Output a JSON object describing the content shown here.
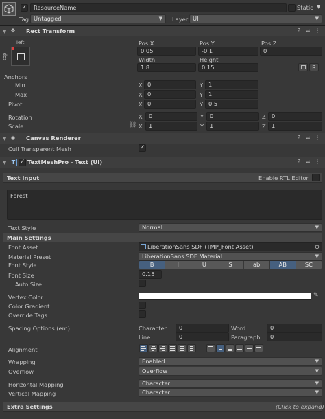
{
  "header": {
    "object_name": "ResourceName",
    "static_label": "Static",
    "tag_label": "Tag",
    "tag_value": "Untagged",
    "layer_label": "Layer",
    "layer_value": "UI"
  },
  "rect_transform": {
    "title": "Rect Transform",
    "anchor_preset_top": "left",
    "anchor_preset_side": "top",
    "pos_x_label": "Pos X",
    "pos_x": "0.05",
    "pos_y_label": "Pos Y",
    "pos_y": "-0.1",
    "pos_z_label": "Pos Z",
    "pos_z": "0",
    "width_label": "Width",
    "width": "1.8",
    "height_label": "Height",
    "height": "0.15",
    "r_button": "R",
    "anchors_label": "Anchors",
    "min_label": "Min",
    "min_x": "0",
    "min_y": "1",
    "max_label": "Max",
    "max_x": "0",
    "max_y": "1",
    "pivot_label": "Pivot",
    "pivot_x": "0",
    "pivot_y": "0.5",
    "rotation_label": "Rotation",
    "rot_x": "0",
    "rot_y": "0",
    "rot_z": "0",
    "scale_label": "Scale",
    "scale_x": "1",
    "scale_y": "1",
    "scale_z": "1",
    "axis_x": "X",
    "axis_y": "Y",
    "axis_z": "Z"
  },
  "canvas_renderer": {
    "title": "Canvas Renderer",
    "cull_label": "Cull Transparent Mesh"
  },
  "tmp": {
    "title": "TextMeshPro - Text (UI)",
    "text_input_label": "Text Input",
    "rtl_label": "Enable RTL Editor",
    "text_value": "Forest",
    "text_style_label": "Text Style",
    "text_style_value": "Normal",
    "main_settings_label": "Main Settings",
    "font_asset_label": "Font Asset",
    "font_asset_value": "LiberationSans SDF (TMP_Font Asset)",
    "material_preset_label": "Material Preset",
    "material_preset_value": "LiberationSans SDF Material",
    "font_style_label": "Font Style",
    "font_style_buttons": [
      "B",
      "I",
      "U",
      "S",
      "ab",
      "AB",
      "SC"
    ],
    "font_size_label": "Font Size",
    "font_size_value": "0.15",
    "auto_size_label": "Auto Size",
    "vertex_color_label": "Vertex Color",
    "vertex_color": "#ffffff",
    "color_gradient_label": "Color Gradient",
    "override_tags_label": "Override Tags",
    "spacing_label": "Spacing Options (em)",
    "character_label": "Character",
    "character_value": "0",
    "word_label": "Word",
    "word_value": "0",
    "line_label": "Line",
    "line_value": "0",
    "paragraph_label": "Paragraph",
    "paragraph_value": "0",
    "alignment_label": "Alignment",
    "wrapping_label": "Wrapping",
    "wrapping_value": "Enabled",
    "overflow_label": "Overflow",
    "overflow_value": "Overflow",
    "h_mapping_label": "Horizontal Mapping",
    "h_mapping_value": "Character",
    "v_mapping_label": "Vertical Mapping",
    "v_mapping_value": "Character",
    "extra_settings_label": "Extra Settings",
    "click_expand": "(Click to expand)"
  },
  "colors": {
    "background": "#383838",
    "selected": "#46607f"
  }
}
